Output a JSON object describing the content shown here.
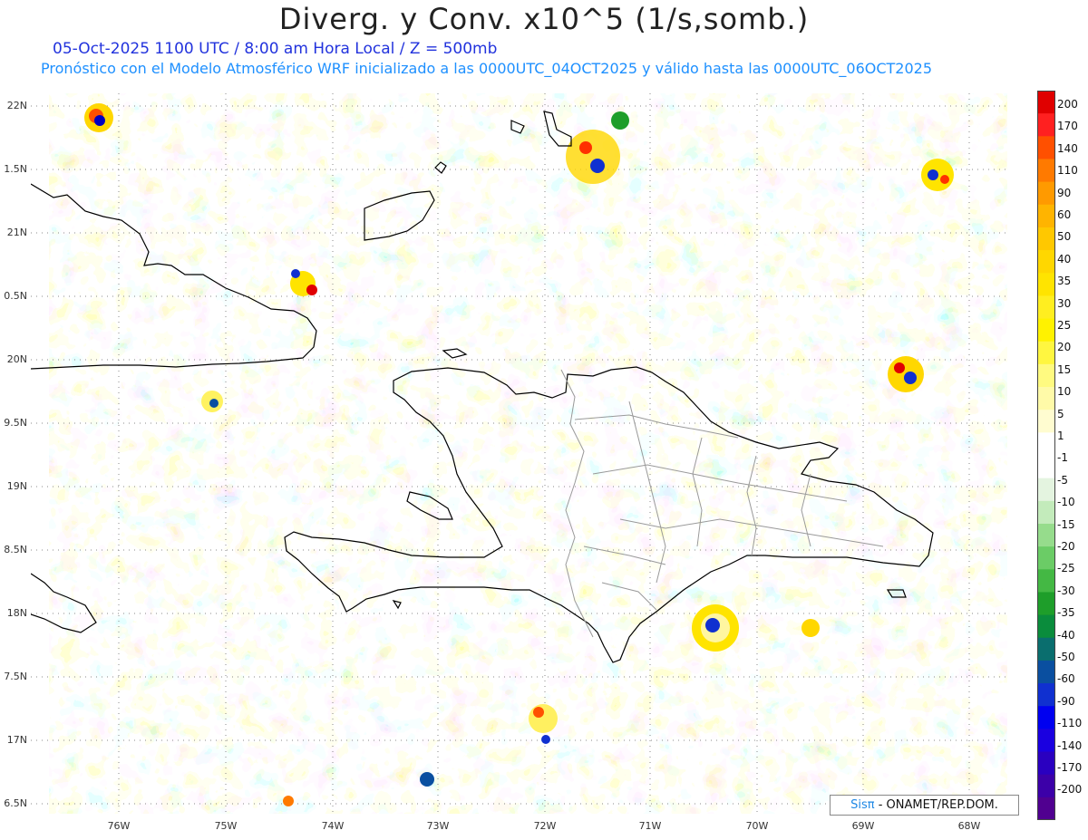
{
  "header": {
    "title": "Diverg. y Conv. x10^5 (1/s,somb.)",
    "subtitle_date": "05-Oct-2025  1100 UTC / 8:00 am Hora Local / Z = 500mb",
    "subtitle_model": "Pronóstico con el Modelo Atmosférico WRF inicializado a las 0000UTC_04OCT2025 y válido hasta las  0000UTC_06OCT2025"
  },
  "map": {
    "lat_labels": [
      "22N",
      "1.5N",
      "21N",
      "0.5N",
      "20N",
      "9.5N",
      "19N",
      "8.5N",
      "18N",
      "7.5N",
      "17N",
      "6.5N"
    ],
    "lon_labels": [
      "76W",
      "75W",
      "74W",
      "73W",
      "72W",
      "71W",
      "70W",
      "69W",
      "68W"
    ]
  },
  "colorbar": {
    "labels": [
      "200",
      "170",
      "140",
      "110",
      "90",
      "60",
      "50",
      "40",
      "35",
      "30",
      "25",
      "20",
      "15",
      "10",
      "5",
      "1",
      "-1",
      "-5",
      "-10",
      "-15",
      "-20",
      "-25",
      "-30",
      "-35",
      "-40",
      "-50",
      "-60",
      "-90",
      "-110",
      "-140",
      "-170",
      "-200"
    ],
    "colors": [
      "#e00000",
      "#ff2020",
      "#ff5000",
      "#ff7a00",
      "#ff9a00",
      "#ffb400",
      "#ffc800",
      "#ffd700",
      "#ffe400",
      "#ffee20",
      "#fff200",
      "#fff640",
      "#fffa80",
      "#fffaa8",
      "#fffcd0",
      "#ffffff",
      "#ffffff",
      "#e4f4e0",
      "#c3ebbb",
      "#96dc8c",
      "#6bcc66",
      "#44b844",
      "#1e9e2a",
      "#0a8c3c",
      "#0a6e6e",
      "#0a4fa0",
      "#1030d0",
      "#0000f0",
      "#1a00e0",
      "#2a00c0",
      "#3c00a8",
      "#500090"
    ]
  },
  "credit": {
    "brand": "Sis",
    "pi": "π",
    "rest": " - ONAMET/REP.DOM."
  }
}
